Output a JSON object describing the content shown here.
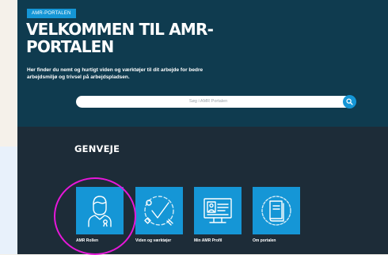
{
  "hero": {
    "badge": "AMR-PORTALEN",
    "title": "VELKOMMEN TIL AMR-PORTALEN",
    "subtitle": "Her finder du nemt og hurtigt viden og værktøjer til dit arbejde for bedre arbejdsmiljø og trivsel på arbejdspladsen."
  },
  "search": {
    "placeholder": "Søg i AMR Portalen",
    "button_icon": "search-icon"
  },
  "shortcuts": {
    "title": "GENVEJE",
    "tiles": [
      {
        "label": "AMR Rollen",
        "icon": "person-badge-icon"
      },
      {
        "label": "Viden og værktøjer",
        "icon": "tools-check-icon"
      },
      {
        "label": "Min AMR Profil",
        "icon": "profile-screen-icon"
      },
      {
        "label": "Om portalen",
        "icon": "book-icon"
      }
    ]
  },
  "colors": {
    "hero_bg": "#0f3b4f",
    "shortcuts_bg": "#1d2c38",
    "accent": "#1596d6",
    "highlight": "#e617d9"
  }
}
